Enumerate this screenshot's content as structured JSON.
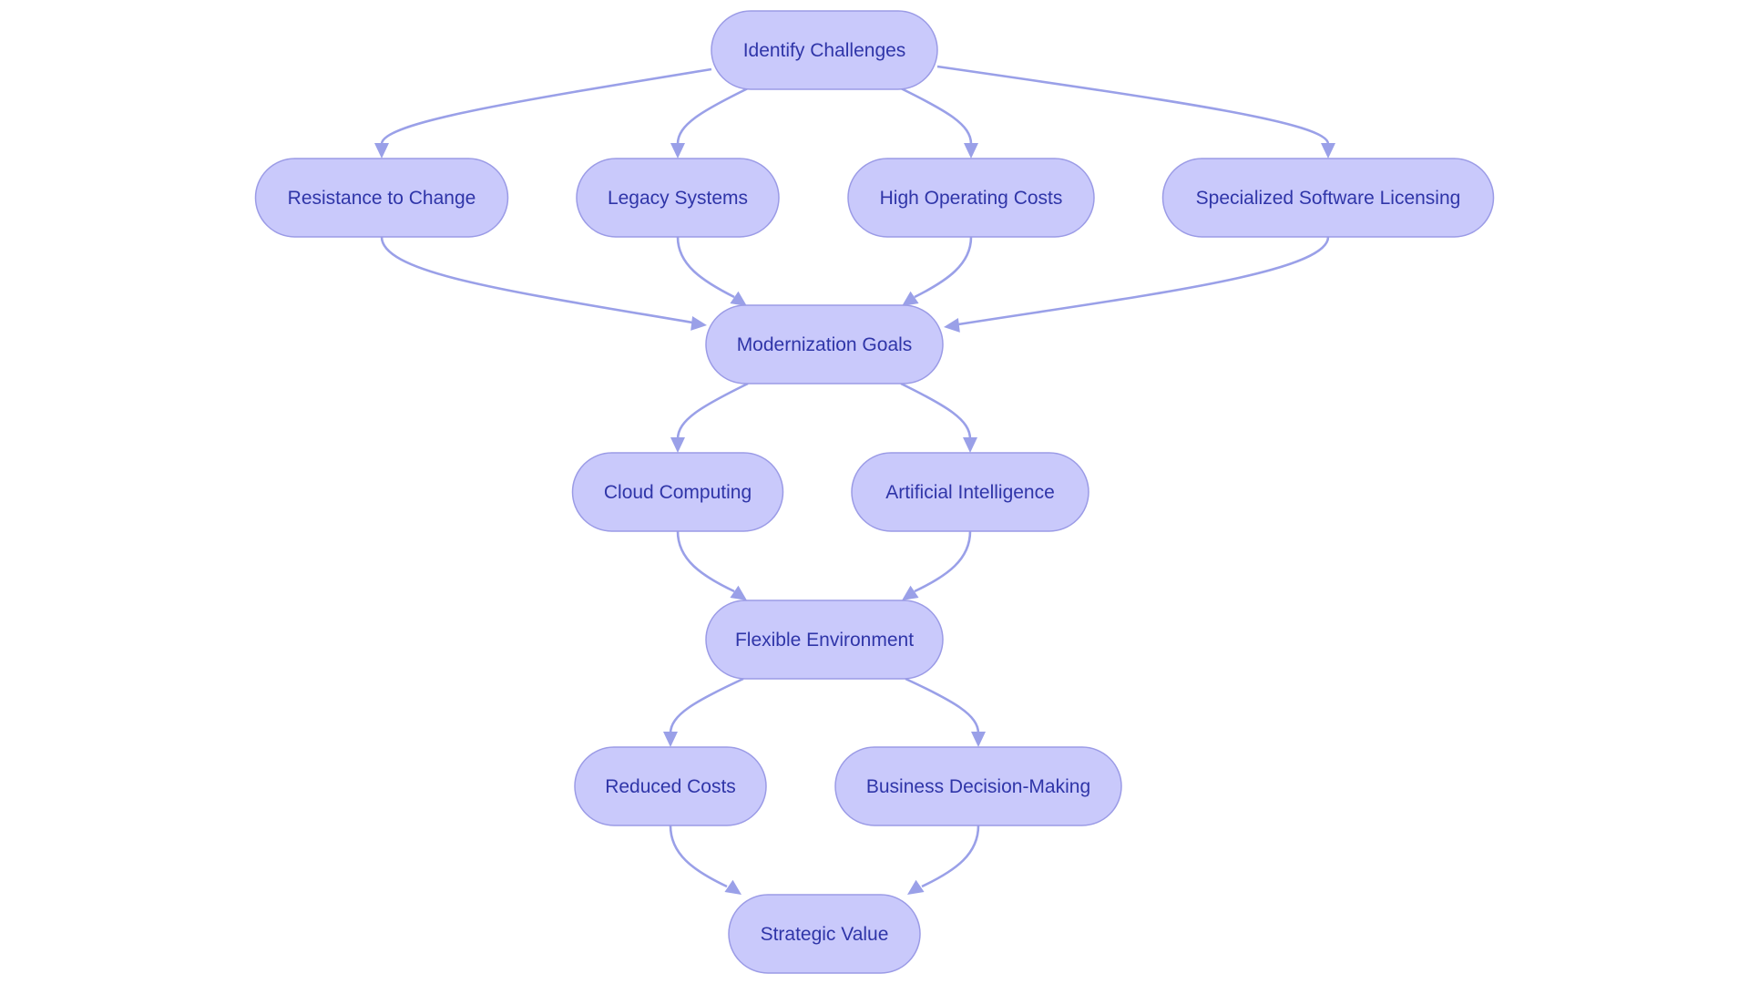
{
  "diagram": {
    "type": "flowchart",
    "colors": {
      "node_fill": "#c9c9fb",
      "node_border": "#9b9be6",
      "text": "#2f35a8",
      "edge": "#9aa0e8",
      "background": "#ffffff"
    },
    "nodes": [
      {
        "id": "identify",
        "label": "Identify Challenges"
      },
      {
        "id": "resistance",
        "label": "Resistance to Change"
      },
      {
        "id": "legacy",
        "label": "Legacy Systems"
      },
      {
        "id": "costs",
        "label": "High Operating Costs"
      },
      {
        "id": "licensing",
        "label": "Specialized Software Licensing"
      },
      {
        "id": "goals",
        "label": "Modernization Goals"
      },
      {
        "id": "cloud",
        "label": "Cloud Computing"
      },
      {
        "id": "ai",
        "label": "Artificial Intelligence"
      },
      {
        "id": "flexible",
        "label": "Flexible Environment"
      },
      {
        "id": "reduced",
        "label": "Reduced Costs"
      },
      {
        "id": "decision",
        "label": "Business Decision-Making"
      },
      {
        "id": "strategic",
        "label": "Strategic Value"
      }
    ],
    "edges": [
      {
        "from": "identify",
        "to": "resistance"
      },
      {
        "from": "identify",
        "to": "legacy"
      },
      {
        "from": "identify",
        "to": "costs"
      },
      {
        "from": "identify",
        "to": "licensing"
      },
      {
        "from": "resistance",
        "to": "goals"
      },
      {
        "from": "legacy",
        "to": "goals"
      },
      {
        "from": "costs",
        "to": "goals"
      },
      {
        "from": "licensing",
        "to": "goals"
      },
      {
        "from": "goals",
        "to": "cloud"
      },
      {
        "from": "goals",
        "to": "ai"
      },
      {
        "from": "cloud",
        "to": "flexible"
      },
      {
        "from": "ai",
        "to": "flexible"
      },
      {
        "from": "flexible",
        "to": "reduced"
      },
      {
        "from": "flexible",
        "to": "decision"
      },
      {
        "from": "reduced",
        "to": "strategic"
      },
      {
        "from": "decision",
        "to": "strategic"
      }
    ]
  }
}
